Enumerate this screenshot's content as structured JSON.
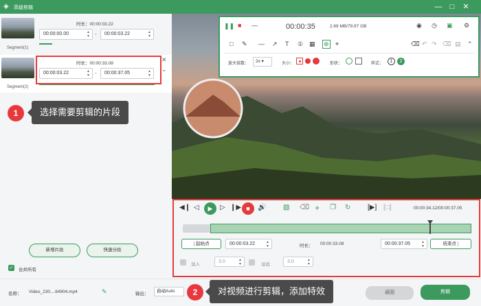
{
  "window": {
    "title": "高级剪辑"
  },
  "segments": [
    {
      "label": "Segment(1)",
      "duration": "时长：00:00:03.22",
      "start": "00:00:00.00",
      "end": "00:00:03.22"
    },
    {
      "label": "Segment(2)",
      "duration": "时长：00:00:33.08",
      "start": "00:00:03.22",
      "end": "00:00:37.05"
    }
  ],
  "callouts": [
    {
      "num": "1",
      "text": "选择需要剪辑的片段"
    },
    {
      "num": "2",
      "text": "对视频进行剪辑，添加特效"
    }
  ],
  "left_buttons": {
    "add_segment": "新增片段",
    "quick_split": "快速分段"
  },
  "merge_all": "合并所有",
  "footer": {
    "name_label": "名称：",
    "file_name": "Video_230....64904.mp4",
    "output_label": "输出：",
    "output_value": "自动Auto",
    "back_button": "返回",
    "cut_button": "剪辑"
  },
  "recorder": {
    "timer": "00:00:35",
    "storage": "2.69 MB/79.97 GB",
    "zoom_label": "放大倍数：",
    "zoom_value": "2x",
    "size_label": "大小：",
    "shape_label": "形状：",
    "style_label": "样式：",
    "style_num1": "1",
    "style_num2": "2"
  },
  "player": {
    "time": "00:00:34.12/00:00:37.05",
    "start_btn": "起始点",
    "start_time": "00:00:03.22",
    "duration_label": "时长：",
    "duration_value": "00:00:33.08",
    "end_time": "00:00:37.05",
    "end_btn": "结束点",
    "fade_in_label": "淡入",
    "fade_in_value": "3.0",
    "fade_out_label": "淡出",
    "fade_out_value": "3.0"
  },
  "colors": {
    "accent": "#3c9a5f",
    "highlight": "#e23b3b",
    "tooltip": "#4a4a4a"
  }
}
